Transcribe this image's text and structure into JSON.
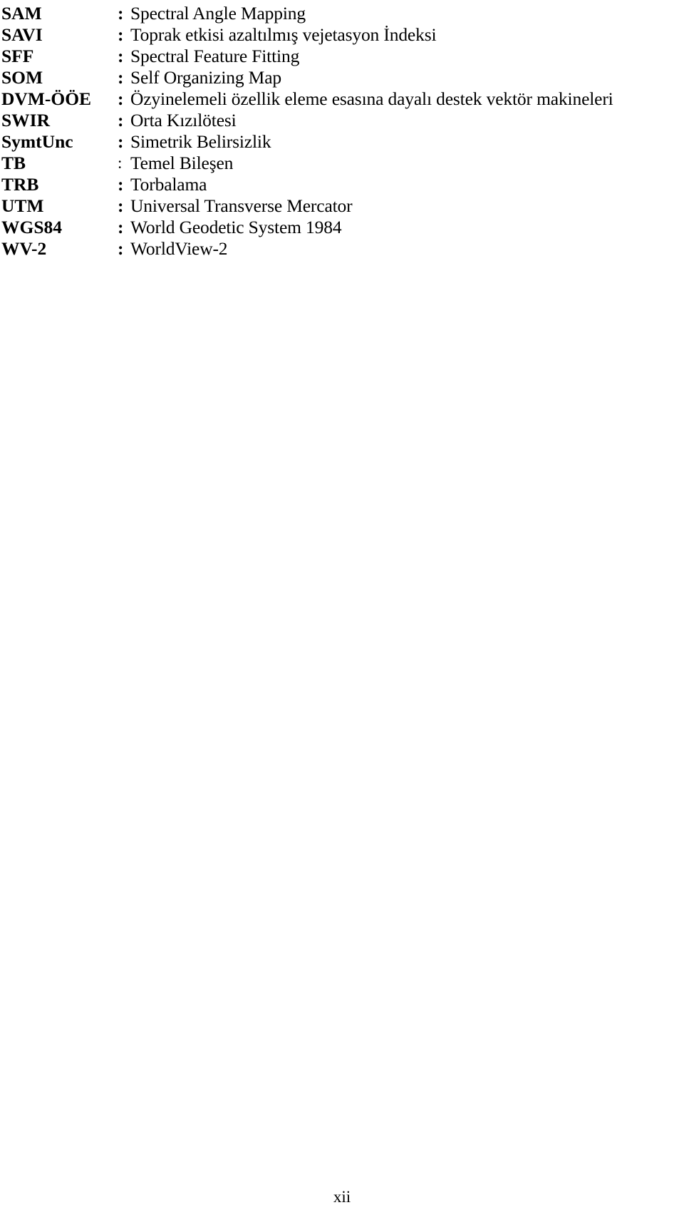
{
  "document": {
    "type": "abbreviations-list",
    "page_number": "xii",
    "separator": ":",
    "entries": [
      {
        "term": "SAM",
        "separator": ":",
        "separator_weight": "bold",
        "definition": "Spectral Angle Mapping"
      },
      {
        "term": "SAVI",
        "separator": ":",
        "separator_weight": "bold",
        "definition": "Toprak etkisi azaltılmış vejetasyon İndeksi"
      },
      {
        "term": "SFF",
        "separator": ":",
        "separator_weight": "bold",
        "definition": "Spectral Feature Fitting"
      },
      {
        "term": "SOM",
        "separator": ":",
        "separator_weight": "bold",
        "definition": "Self Organizing Map"
      },
      {
        "term": "DVM-ÖÖE",
        "separator": ":",
        "separator_weight": "bold",
        "definition": "Özyinelemeli özellik eleme esasına dayalı destek vektör makineleri"
      },
      {
        "term": "SWIR",
        "separator": ":",
        "separator_weight": "bold",
        "definition": "Orta Kızılötesi"
      },
      {
        "term": "SymtUnc",
        "separator": ":",
        "separator_weight": "bold",
        "definition": "Simetrik Belirsizlik"
      },
      {
        "term": "TB",
        "separator": ":",
        "separator_weight": "regular",
        "definition": "Temel Bileşen"
      },
      {
        "term": "TRB",
        "separator": ":",
        "separator_weight": "bold",
        "definition": "Torbalama"
      },
      {
        "term": "UTM",
        "separator": ":",
        "separator_weight": "bold",
        "definition": "Universal Transverse Mercator"
      },
      {
        "term": "WGS84",
        "separator": ":",
        "separator_weight": "bold",
        "definition": "World Geodetic System 1984"
      },
      {
        "term": "WV-2",
        "separator": ":",
        "separator_weight": "bold",
        "definition": "WorldView-2"
      }
    ]
  }
}
